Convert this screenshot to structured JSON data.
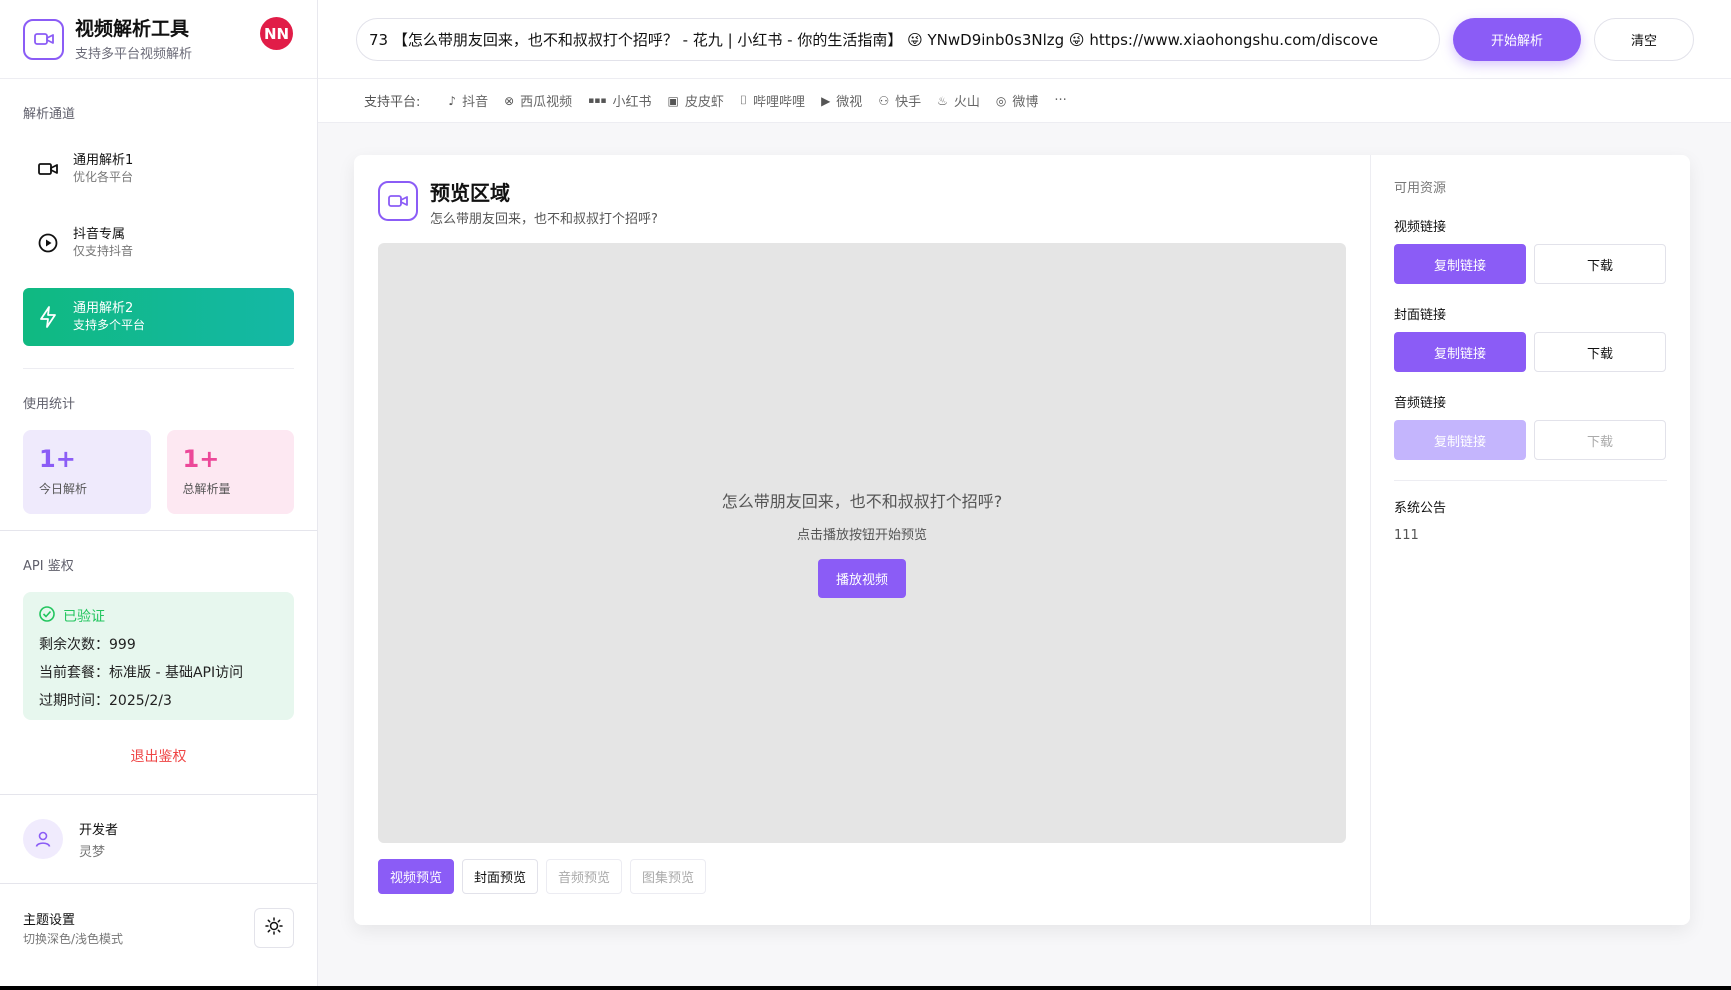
{
  "brand": {
    "title": "视频解析工具",
    "subtitle": "支持多平台视频解析",
    "avatar_initials": "NN"
  },
  "sidebar": {
    "channels_label": "解析通道",
    "channels": [
      {
        "title": "通用解析1",
        "subtitle": "优化各平台",
        "icon": "video-camera-icon",
        "active": false
      },
      {
        "title": "抖音专属",
        "subtitle": "仅支持抖音",
        "icon": "play-circle-icon",
        "active": false
      },
      {
        "title": "通用解析2",
        "subtitle": "支持多个平台",
        "icon": "lightning-icon",
        "active": true
      }
    ],
    "stats_label": "使用统计",
    "stats": [
      {
        "value": "1+",
        "label": "今日解析"
      },
      {
        "value": "1+",
        "label": "总解析量"
      }
    ],
    "auth": {
      "label": "API 鉴权",
      "status": "已验证",
      "remaining": "剩余次数：999",
      "plan": "当前套餐：标准版 - 基础API访问",
      "expires": "过期时间：2025/2/3",
      "logout": "退出鉴权"
    },
    "developer": {
      "title": "开发者",
      "name": "灵梦"
    },
    "theme": {
      "title": "主题设置",
      "subtitle": "切换深色/浅色模式"
    }
  },
  "topbar": {
    "input_value": "73 【怎么带朋友回来，也不和叔叔打个招呼？ - 花九 | 小红书 - 你的生活指南】 😜 YNwD9inb0s3Nlzg 😜 https://www.xiaohongshu.com/discove",
    "parse_label": "开始解析",
    "clear_label": "清空"
  },
  "platforms": {
    "label": "支持平台:",
    "items": [
      {
        "name": "抖音",
        "icon": "tiktok-icon"
      },
      {
        "name": "西瓜视频",
        "icon": "xigua-icon"
      },
      {
        "name": "小红书",
        "icon": "xiaohongshu-icon"
      },
      {
        "name": "皮皮虾",
        "icon": "pipixia-icon"
      },
      {
        "name": "哔哩哔哩",
        "icon": "bilibili-icon"
      },
      {
        "name": "微视",
        "icon": "weishi-icon"
      },
      {
        "name": "快手",
        "icon": "kuaishou-icon"
      },
      {
        "name": "火山",
        "icon": "huoshan-icon"
      },
      {
        "name": "微博",
        "icon": "weibo-icon"
      }
    ],
    "more": "···"
  },
  "preview": {
    "title": "预览区域",
    "subtitle": "怎么带朋友回来，也不和叔叔打个招呼?",
    "stage_title": "怎么带朋友回来，也不和叔叔打个招呼?",
    "stage_hint": "点击播放按钮开始预览",
    "play_label": "播放视频",
    "tabs": [
      "视频预览",
      "封面预览",
      "音频预览",
      "图集预览"
    ]
  },
  "resources": {
    "label": "可用资源",
    "items": [
      {
        "label": "视频链接",
        "copy": "复制链接",
        "download": "下载",
        "enabled": true
      },
      {
        "label": "封面链接",
        "copy": "复制链接",
        "download": "下载",
        "enabled": true
      },
      {
        "label": "音频链接",
        "copy": "复制链接",
        "download": "下载",
        "enabled": false
      }
    ],
    "notice_title": "系统公告",
    "notice_body": "111"
  },
  "colors": {
    "accent": "#8b5cf6",
    "active_channel": "#10b981",
    "avatar": "#e11d48",
    "danger": "#ef4444",
    "success": "#22c55e"
  }
}
